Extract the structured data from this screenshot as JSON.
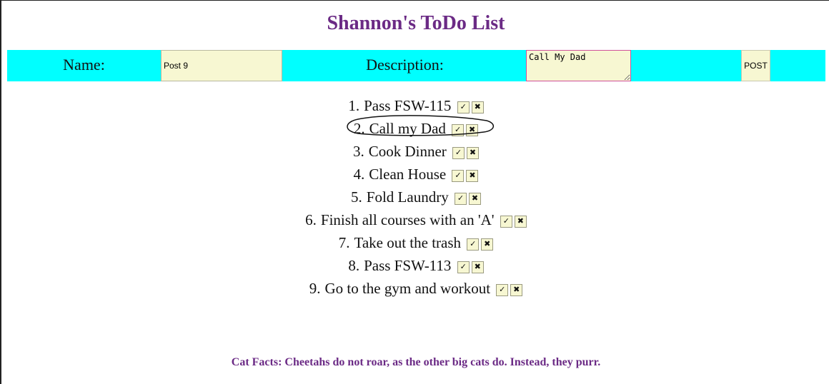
{
  "title": "Shannon's ToDo List",
  "form": {
    "name_label": "Name:",
    "name_value": "Post 9",
    "description_label": "Description:",
    "description_value": "Call My Dad",
    "post_label": "POST"
  },
  "todos": [
    {
      "number": "1.",
      "text": "Pass FSW-115"
    },
    {
      "number": "2.",
      "text": "Call my Dad",
      "circled": true
    },
    {
      "number": "3.",
      "text": "Cook Dinner"
    },
    {
      "number": "4.",
      "text": "Clean House"
    },
    {
      "number": "5.",
      "text": "Fold Laundry"
    },
    {
      "number": "6.",
      "text": "Finish all courses with an 'A'"
    },
    {
      "number": "7.",
      "text": "Take out the trash"
    },
    {
      "number": "8.",
      "text": "Pass FSW-113"
    },
    {
      "number": "9.",
      "text": "Go to the gym and workout"
    }
  ],
  "item_buttons": {
    "complete": "✓",
    "delete": "✖"
  },
  "cat_fact": "Cat Facts: Cheetahs do not roar, as the other big cats do. Instead, they purr.",
  "colors": {
    "title": "#6b2a85",
    "form_bar": "#00ffff",
    "input_bg": "#f7f7d2",
    "desc_border": "#d0509a"
  },
  "icons": {
    "complete": "check-icon",
    "delete": "x-icon"
  }
}
